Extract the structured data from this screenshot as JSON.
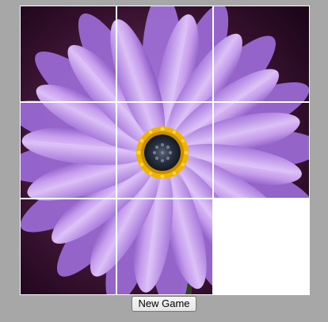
{
  "puzzle": {
    "grid": {
      "rows": 3,
      "cols": 3
    },
    "image_subject": "purple-daisy-flower",
    "empty_position": {
      "row": 3,
      "col": 3
    },
    "colors": {
      "background": "#a7a7a7",
      "petal_light": "#d8b6f2",
      "petal_mid": "#b88ae6",
      "petal_dark": "#7e4fb6",
      "backdrop_dark": "#2a0a24",
      "backdrop_mid": "#6c2e5f",
      "center_dark": "#1b1f2c",
      "center_ring": "#f0b400",
      "empty_tile": "#ffffff",
      "grid_line": "#ffffff"
    }
  },
  "controls": {
    "new_game_label": "New Game"
  }
}
